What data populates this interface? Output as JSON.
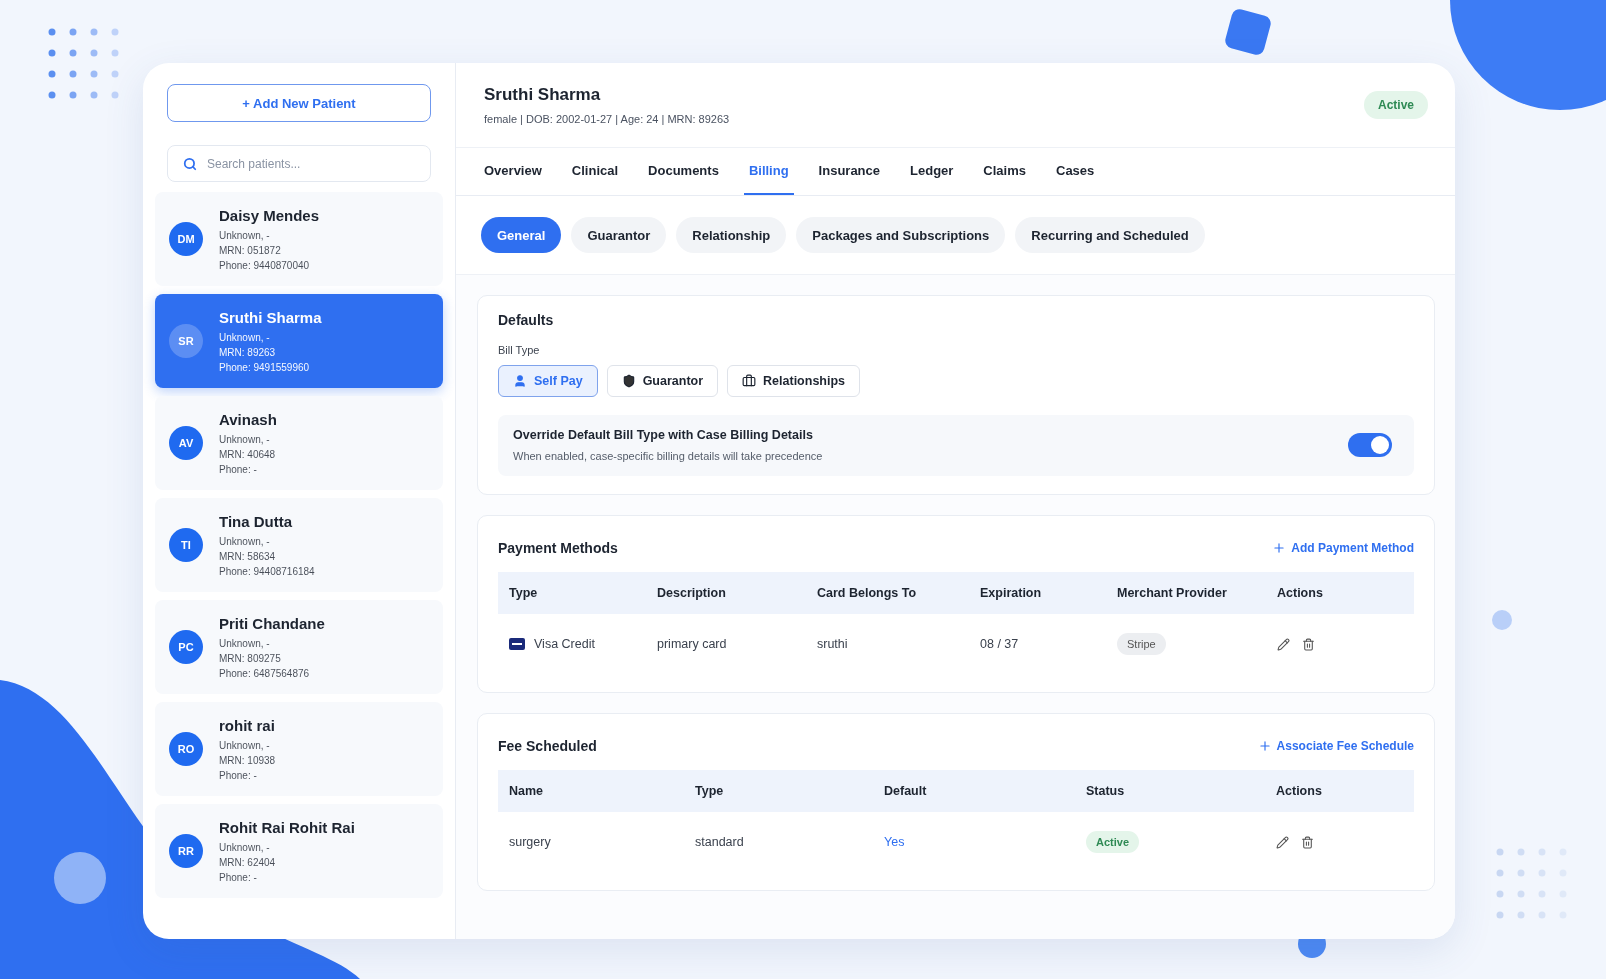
{
  "sidebar": {
    "add_button": "+ Add New Patient",
    "search": {
      "placeholder": "Search patients..."
    },
    "patients": [
      {
        "initials": "DM",
        "name": "Daisy Mendes",
        "info": "Unknown, -",
        "mrn": "MRN: 051872",
        "phone": "Phone: 9440870040",
        "selected": false
      },
      {
        "initials": "SR",
        "name": "Sruthi Sharma",
        "info": "Unknown, -",
        "mrn": "MRN: 89263",
        "phone": "Phone: 9491559960",
        "selected": true
      },
      {
        "initials": "AV",
        "name": "Avinash",
        "info": "Unknown, -",
        "mrn": "MRN: 40648",
        "phone": "Phone: -",
        "selected": false
      },
      {
        "initials": "TI",
        "name": "Tina Dutta",
        "info": "Unknown, -",
        "mrn": "MRN: 58634",
        "phone": "Phone: 94408716184",
        "selected": false
      },
      {
        "initials": "PC",
        "name": "Priti Chandane",
        "info": "Unknown, -",
        "mrn": "MRN: 809275",
        "phone": "Phone: 6487564876",
        "selected": false
      },
      {
        "initials": "RO",
        "name": "rohit rai",
        "info": "Unknown, -",
        "mrn": "MRN: 10938",
        "phone": "Phone: -",
        "selected": false
      },
      {
        "initials": "RR",
        "name": "Rohit Rai Rohit Rai",
        "info": "Unknown, -",
        "mrn": "MRN: 62404",
        "phone": "Phone: -",
        "selected": false
      }
    ]
  },
  "header": {
    "name": "Sruthi Sharma",
    "details": "female | DOB: 2002-01-27 | Age: 24 | MRN: 89263",
    "status": "Active"
  },
  "tabs": [
    {
      "label": "Overview",
      "selected": false
    },
    {
      "label": "Clinical",
      "selected": false
    },
    {
      "label": "Documents",
      "selected": false
    },
    {
      "label": "Billing",
      "selected": true
    },
    {
      "label": "Insurance",
      "selected": false
    },
    {
      "label": "Ledger",
      "selected": false
    },
    {
      "label": "Claims",
      "selected": false
    },
    {
      "label": "Cases",
      "selected": false
    }
  ],
  "subtabs": [
    {
      "label": "General",
      "selected": true
    },
    {
      "label": "Guarantor",
      "selected": false
    },
    {
      "label": "Relationship",
      "selected": false
    },
    {
      "label": "Packages and Subscriptions",
      "selected": false
    },
    {
      "label": "Recurring and Scheduled",
      "selected": false
    }
  ],
  "defaults": {
    "title": "Defaults",
    "bill_type_label": "Bill Type",
    "bill_types": [
      {
        "kind": "person",
        "label": "Self Pay",
        "selected": true
      },
      {
        "kind": "shield",
        "label": "Guarantor",
        "selected": false
      },
      {
        "kind": "briefcase",
        "label": "Relationships",
        "selected": false
      }
    ],
    "override": {
      "title": "Override Default Bill Type with Case Billing Details",
      "description": "When enabled, case-specific billing details will take precedence",
      "on": true
    }
  },
  "payment_methods": {
    "title": "Payment Methods",
    "action": "Add Payment Method",
    "columns": [
      "Type",
      "Description",
      "Card Belongs To",
      "Expiration",
      "Merchant Provider",
      "Actions"
    ],
    "rows": [
      {
        "type": "Visa Credit",
        "description": "primary card",
        "card_belongs_to": "sruthi",
        "expiration": "08 / 37",
        "merchant_provider": "Stripe"
      }
    ]
  },
  "fee_scheduled": {
    "title": "Fee Scheduled",
    "action": "Associate Fee Schedule",
    "columns": [
      "Name",
      "Type",
      "Default",
      "Status",
      "Actions"
    ],
    "rows": [
      {
        "name": "surgery",
        "type": "standard",
        "default": "Yes",
        "status": "Active"
      }
    ]
  }
}
